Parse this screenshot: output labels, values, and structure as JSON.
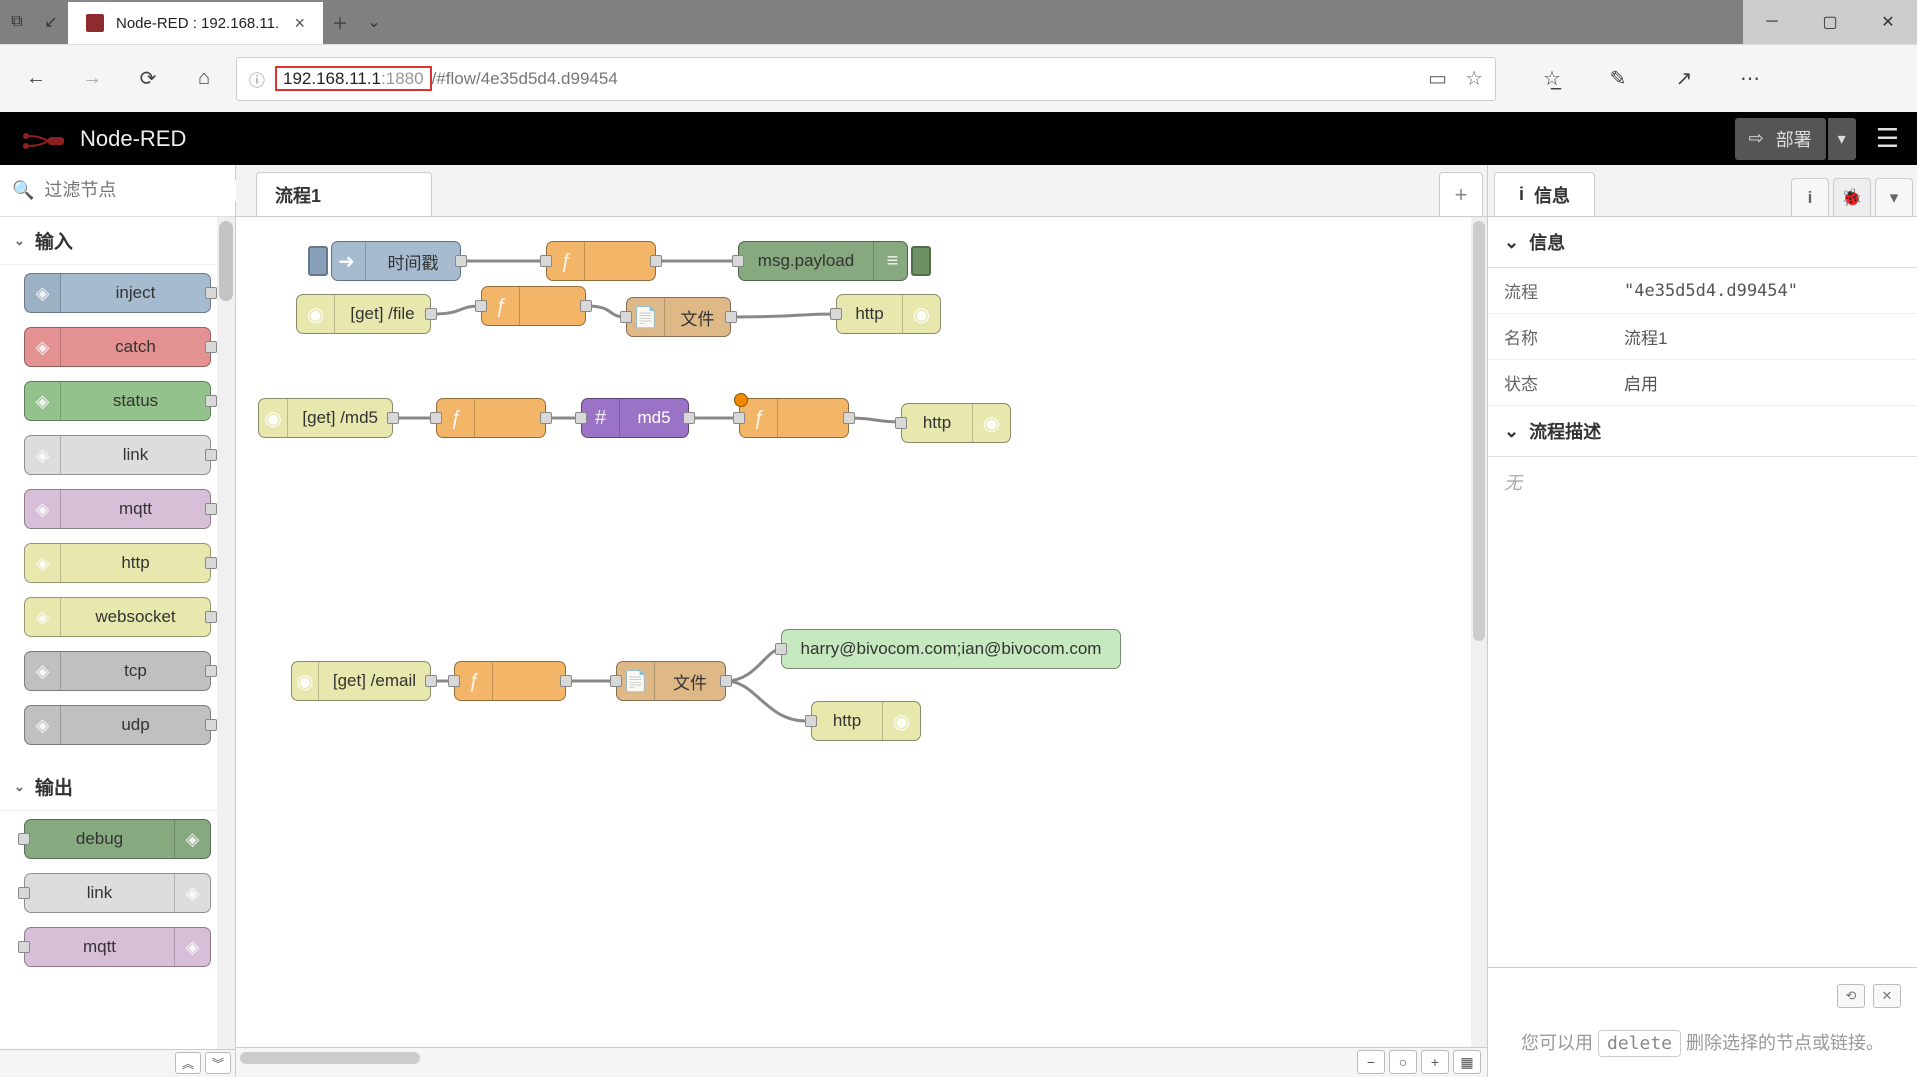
{
  "browser": {
    "tab_title": "Node-RED : 192.168.11.",
    "url_host": "192.168.11.1",
    "url_port": ":1880",
    "url_path": "/#flow/4e35d5d4.d99454"
  },
  "header": {
    "title": "Node-RED",
    "deploy_label": "部署"
  },
  "palette": {
    "search_placeholder": "过滤节点",
    "cat_input": "输入",
    "cat_output": "输出",
    "nodes_input": [
      {
        "label": "inject",
        "color": "c-inject"
      },
      {
        "label": "catch",
        "color": "c-catch"
      },
      {
        "label": "status",
        "color": "c-status"
      },
      {
        "label": "link",
        "color": "c-link"
      },
      {
        "label": "mqtt",
        "color": "c-mqtt"
      },
      {
        "label": "http",
        "color": "c-http"
      },
      {
        "label": "websocket",
        "color": "c-ws"
      },
      {
        "label": "tcp",
        "color": "c-tcp"
      },
      {
        "label": "udp",
        "color": "c-udp"
      }
    ],
    "nodes_output": [
      {
        "label": "debug",
        "color": "c-debug"
      },
      {
        "label": "link",
        "color": "c-link"
      },
      {
        "label": "mqtt",
        "color": "c-mqtt"
      }
    ]
  },
  "workspace": {
    "tab_label": "流程1",
    "nodes": {
      "inject1": "时间戳",
      "debug1": "msg.payload",
      "httpin_file": "[get] /file",
      "file1": "文件",
      "http1": "http",
      "httpin_md5": "[get] /md5",
      "md5": "md5",
      "http2": "http",
      "httpin_email": "[get] /email",
      "file2": "文件",
      "email": "harry@bivocom.com;ian@bivocom.com",
      "http3": "http"
    }
  },
  "sidebar": {
    "tab_info": "信息",
    "section_info": "信息",
    "section_desc": "流程描述",
    "row_flow": "流程",
    "row_flow_val": "\"4e35d5d4.d99454\"",
    "row_name": "名称",
    "row_name_val": "流程1",
    "row_status": "状态",
    "row_status_val": "启用",
    "desc_empty": "无",
    "tip_pre": "您可以用",
    "tip_key": "delete",
    "tip_post": "删除选择的节点或链接。"
  }
}
